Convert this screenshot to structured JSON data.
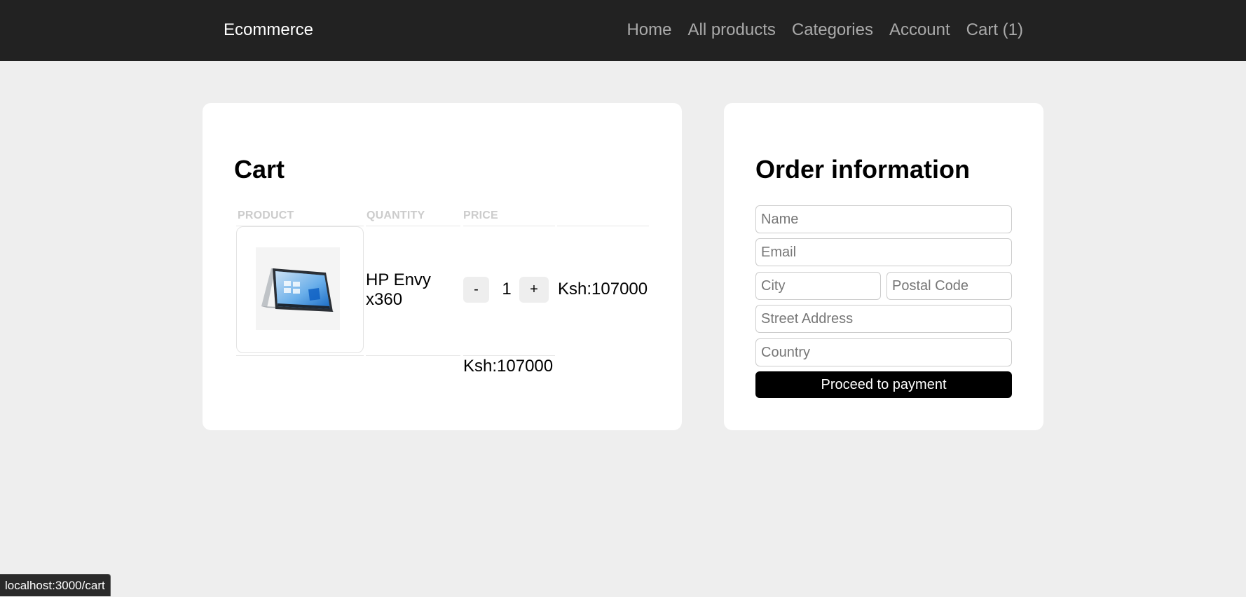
{
  "header": {
    "brand": "Ecommerce",
    "nav": [
      "Home",
      "All products",
      "Categories",
      "Account",
      "Cart (1)"
    ]
  },
  "cart": {
    "title": "Cart",
    "columns": [
      "PRODUCT",
      "QUANTITY",
      "PRICE",
      ""
    ],
    "items": [
      {
        "image_icon": "laptop-image",
        "name": "HP Envy x360",
        "decrement_label": "-",
        "quantity": "1",
        "increment_label": "+",
        "price": "Ksh:107000"
      }
    ],
    "total": "Ksh:107000"
  },
  "order": {
    "title": "Order information",
    "fields": {
      "name": {
        "placeholder": "Name",
        "value": ""
      },
      "email": {
        "placeholder": "Email",
        "value": ""
      },
      "city": {
        "placeholder": "City",
        "value": ""
      },
      "postal_code": {
        "placeholder": "Postal Code",
        "value": ""
      },
      "street_address": {
        "placeholder": "Street Address",
        "value": ""
      },
      "country": {
        "placeholder": "Country",
        "value": ""
      }
    },
    "submit_label": "Proceed to payment"
  },
  "status_bar": {
    "url": "localhost:3000/cart"
  },
  "colors": {
    "header_bg": "#222222",
    "page_bg": "#eeeeee",
    "nav_link": "#aaaaaa",
    "primary_button": "#000000"
  }
}
